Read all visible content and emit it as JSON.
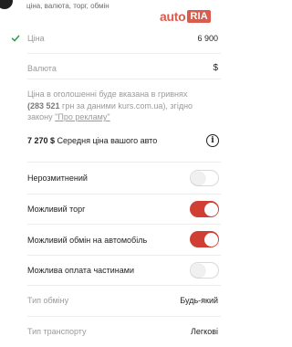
{
  "header": {
    "subtitle": "ціна, валюта, торг, обмін",
    "logo_auto": "auto",
    "logo_ria": "RIA"
  },
  "price": {
    "label": "Ціна",
    "value": "6 900"
  },
  "currency": {
    "label": "Валюта",
    "value": "$"
  },
  "info": {
    "line1": "Ціна в оголошенні буде вказана в гривнях",
    "uah_amount": "(283 521",
    "line2_rest": " грн за даними kurs.com.ua), згідно",
    "line3_prefix": "закону ",
    "link_text": "\"Про рекламу\""
  },
  "average": {
    "amount": "7 270 $",
    "text": " Середня ціна вашого авто"
  },
  "toggles": [
    {
      "label": "Нерозмитнений",
      "on": false
    },
    {
      "label": "Можливий торг",
      "on": true
    },
    {
      "label": "Можливий обмін на автомобіль",
      "on": true
    },
    {
      "label": "Можлива оплата частинами",
      "on": false
    }
  ],
  "exchange_type": {
    "label": "Тип обміну",
    "value": "Будь-який"
  },
  "transport_type": {
    "label": "Тип транспорту",
    "value": "Легкові"
  },
  "colors": {
    "accent_red": "#cf3f33",
    "check_green": "#2e9e4f",
    "logo_red": "#db5c4c"
  }
}
